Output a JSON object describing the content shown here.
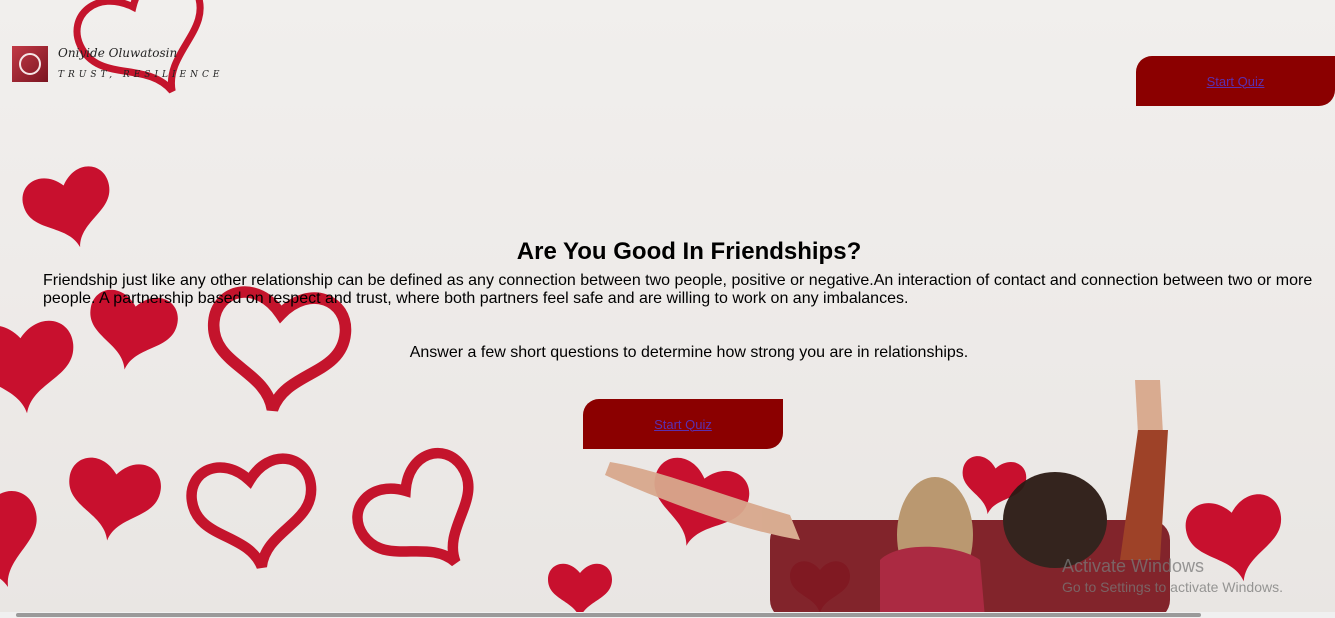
{
  "logo": {
    "name": "Oniyide Oluwatosin",
    "tagline": "TRUST, RESILIENCE"
  },
  "header": {
    "start_quiz_label": "Start Quiz"
  },
  "main": {
    "title": "Are You Good In Friendships?",
    "description": "Friendship just like any other relationship can be defined as any connection between two people, positive or negative.An interaction of contact and connection between two or more people. A partnership based on respect and trust, where both partners feel safe and are willing to work on any imbalances.",
    "prompt": "Answer a few short questions to determine how strong you are in relationships.",
    "start_quiz_label": "Start Quiz"
  },
  "watermark": {
    "title": "Activate Windows",
    "subtitle": "Go to Settings to activate Windows."
  },
  "colors": {
    "accent": "#8b0000",
    "heart": "#c8102e",
    "link": "#5b2fb0"
  }
}
